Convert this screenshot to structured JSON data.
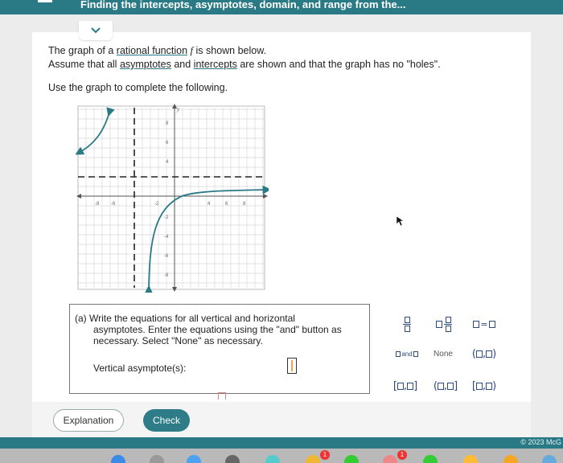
{
  "header": {
    "title": "Finding the intercepts, asymptotes, domain, and range from the..."
  },
  "intro": {
    "line1_pre": "The graph of a ",
    "line1_link": "rational function",
    "line1_var": "f",
    "line1_post": " is shown below.",
    "line2_pre": "Assume that all ",
    "line2_link1": "asymptotes",
    "line2_mid": " and ",
    "line2_link2": "intercepts",
    "line2_post": " are shown and that the graph has no \"holes\".",
    "line3": "Use the graph to complete the following."
  },
  "graph": {
    "x_ticks": [
      "-8",
      "-6",
      "-2",
      "4",
      "6",
      "8"
    ],
    "y_ticks": [
      "8",
      "6",
      "4",
      "-2",
      "-4",
      "-6",
      "-8"
    ],
    "x_axis_label": "x",
    "y_axis_label": "y"
  },
  "question": {
    "part_a_line1": "(a) Write the equations for all vertical and horizontal",
    "part_a_line2": "asymptotes. Enter the equations using the \"and\" button as",
    "part_a_line3": "necessary. Select \"None\" as necessary.",
    "vertical_label": "Vertical asymptote(s):"
  },
  "palette": {
    "equals": "=",
    "and_text": "and",
    "none": "None",
    "comma": ","
  },
  "buttons": {
    "explanation": "Explanation",
    "check": "Check"
  },
  "footer": {
    "copyright": "© 2023 McG"
  },
  "dock": {
    "badge1": "1",
    "badge2": "1"
  },
  "colors": {
    "teal": "#2a7a86",
    "curve": "#2a7a86",
    "button": "#2d7c88"
  }
}
